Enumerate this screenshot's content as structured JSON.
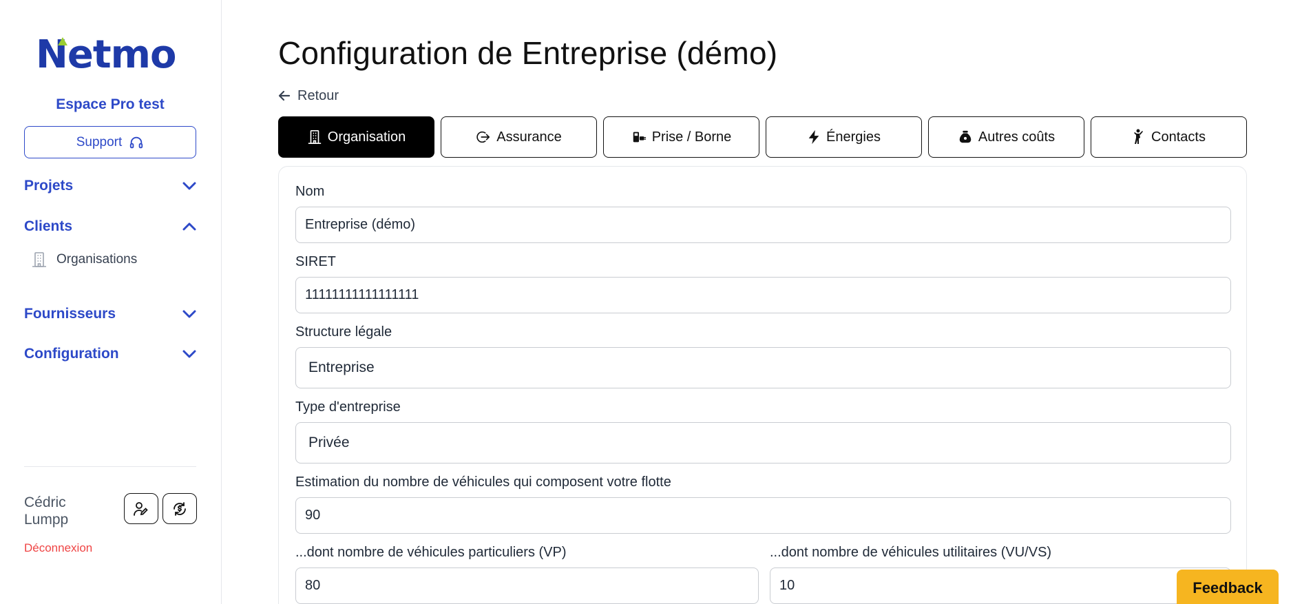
{
  "sidebar": {
    "logo": "Netmo",
    "space_name": "Espace Pro test",
    "support_label": "Support",
    "nav": {
      "projets": "Projets",
      "clients": "Clients",
      "organisations": "Organisations",
      "fournisseurs": "Fournisseurs",
      "configuration": "Configuration"
    },
    "user": {
      "first_name": "Cédric",
      "last_name": "Lumpp"
    },
    "logout_label": "Déconnexion"
  },
  "main": {
    "title": "Configuration de Entreprise (démo)",
    "back_label": "Retour",
    "tabs": [
      {
        "label": "Organisation",
        "icon": "building-icon",
        "active": true
      },
      {
        "label": "Assurance",
        "icon": "insurance-icon",
        "active": false
      },
      {
        "label": "Prise / Borne",
        "icon": "charging-plug-icon",
        "active": false
      },
      {
        "label": "Énergies",
        "icon": "lightning-icon",
        "active": false
      },
      {
        "label": "Autres coûts",
        "icon": "money-bag-icon",
        "active": false
      },
      {
        "label": "Contacts",
        "icon": "person-icon",
        "active": false
      }
    ],
    "form": {
      "nom": {
        "label": "Nom",
        "value": "Entreprise (démo)"
      },
      "siret": {
        "label": "SIRET",
        "value": "11111111111111111"
      },
      "structure": {
        "label": "Structure légale",
        "value": "Entreprise"
      },
      "type": {
        "label": "Type d'entreprise",
        "value": "Privée"
      },
      "fleet": {
        "label": "Estimation du nombre de véhicules qui composent votre flotte",
        "value": "90"
      },
      "vp": {
        "label": "...dont nombre de véhicules particuliers (VP)",
        "value": "80"
      },
      "vu": {
        "label": "...dont nombre de véhicules utilitaires (VU/VS)",
        "value": "10"
      }
    }
  },
  "feedback_label": "Feedback",
  "colors": {
    "brand": "#2d49c8",
    "logo": "#1e3aa8",
    "danger": "#ef4444",
    "feedback": "#f6b520",
    "leaf": "#9acd32"
  }
}
